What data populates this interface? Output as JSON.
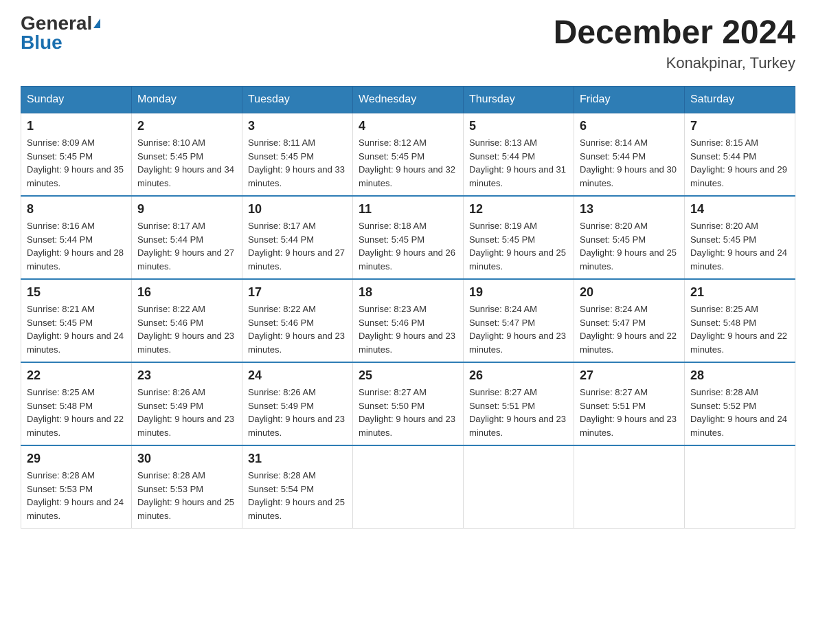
{
  "header": {
    "logo_general": "General",
    "logo_blue": "Blue",
    "title": "December 2024",
    "location": "Konakpinar, Turkey"
  },
  "weekdays": [
    "Sunday",
    "Monday",
    "Tuesday",
    "Wednesday",
    "Thursday",
    "Friday",
    "Saturday"
  ],
  "weeks": [
    [
      {
        "day": "1",
        "sunrise": "Sunrise: 8:09 AM",
        "sunset": "Sunset: 5:45 PM",
        "daylight": "Daylight: 9 hours and 35 minutes."
      },
      {
        "day": "2",
        "sunrise": "Sunrise: 8:10 AM",
        "sunset": "Sunset: 5:45 PM",
        "daylight": "Daylight: 9 hours and 34 minutes."
      },
      {
        "day": "3",
        "sunrise": "Sunrise: 8:11 AM",
        "sunset": "Sunset: 5:45 PM",
        "daylight": "Daylight: 9 hours and 33 minutes."
      },
      {
        "day": "4",
        "sunrise": "Sunrise: 8:12 AM",
        "sunset": "Sunset: 5:45 PM",
        "daylight": "Daylight: 9 hours and 32 minutes."
      },
      {
        "day": "5",
        "sunrise": "Sunrise: 8:13 AM",
        "sunset": "Sunset: 5:44 PM",
        "daylight": "Daylight: 9 hours and 31 minutes."
      },
      {
        "day": "6",
        "sunrise": "Sunrise: 8:14 AM",
        "sunset": "Sunset: 5:44 PM",
        "daylight": "Daylight: 9 hours and 30 minutes."
      },
      {
        "day": "7",
        "sunrise": "Sunrise: 8:15 AM",
        "sunset": "Sunset: 5:44 PM",
        "daylight": "Daylight: 9 hours and 29 minutes."
      }
    ],
    [
      {
        "day": "8",
        "sunrise": "Sunrise: 8:16 AM",
        "sunset": "Sunset: 5:44 PM",
        "daylight": "Daylight: 9 hours and 28 minutes."
      },
      {
        "day": "9",
        "sunrise": "Sunrise: 8:17 AM",
        "sunset": "Sunset: 5:44 PM",
        "daylight": "Daylight: 9 hours and 27 minutes."
      },
      {
        "day": "10",
        "sunrise": "Sunrise: 8:17 AM",
        "sunset": "Sunset: 5:44 PM",
        "daylight": "Daylight: 9 hours and 27 minutes."
      },
      {
        "day": "11",
        "sunrise": "Sunrise: 8:18 AM",
        "sunset": "Sunset: 5:45 PM",
        "daylight": "Daylight: 9 hours and 26 minutes."
      },
      {
        "day": "12",
        "sunrise": "Sunrise: 8:19 AM",
        "sunset": "Sunset: 5:45 PM",
        "daylight": "Daylight: 9 hours and 25 minutes."
      },
      {
        "day": "13",
        "sunrise": "Sunrise: 8:20 AM",
        "sunset": "Sunset: 5:45 PM",
        "daylight": "Daylight: 9 hours and 25 minutes."
      },
      {
        "day": "14",
        "sunrise": "Sunrise: 8:20 AM",
        "sunset": "Sunset: 5:45 PM",
        "daylight": "Daylight: 9 hours and 24 minutes."
      }
    ],
    [
      {
        "day": "15",
        "sunrise": "Sunrise: 8:21 AM",
        "sunset": "Sunset: 5:45 PM",
        "daylight": "Daylight: 9 hours and 24 minutes."
      },
      {
        "day": "16",
        "sunrise": "Sunrise: 8:22 AM",
        "sunset": "Sunset: 5:46 PM",
        "daylight": "Daylight: 9 hours and 23 minutes."
      },
      {
        "day": "17",
        "sunrise": "Sunrise: 8:22 AM",
        "sunset": "Sunset: 5:46 PM",
        "daylight": "Daylight: 9 hours and 23 minutes."
      },
      {
        "day": "18",
        "sunrise": "Sunrise: 8:23 AM",
        "sunset": "Sunset: 5:46 PM",
        "daylight": "Daylight: 9 hours and 23 minutes."
      },
      {
        "day": "19",
        "sunrise": "Sunrise: 8:24 AM",
        "sunset": "Sunset: 5:47 PM",
        "daylight": "Daylight: 9 hours and 23 minutes."
      },
      {
        "day": "20",
        "sunrise": "Sunrise: 8:24 AM",
        "sunset": "Sunset: 5:47 PM",
        "daylight": "Daylight: 9 hours and 22 minutes."
      },
      {
        "day": "21",
        "sunrise": "Sunrise: 8:25 AM",
        "sunset": "Sunset: 5:48 PM",
        "daylight": "Daylight: 9 hours and 22 minutes."
      }
    ],
    [
      {
        "day": "22",
        "sunrise": "Sunrise: 8:25 AM",
        "sunset": "Sunset: 5:48 PM",
        "daylight": "Daylight: 9 hours and 22 minutes."
      },
      {
        "day": "23",
        "sunrise": "Sunrise: 8:26 AM",
        "sunset": "Sunset: 5:49 PM",
        "daylight": "Daylight: 9 hours and 23 minutes."
      },
      {
        "day": "24",
        "sunrise": "Sunrise: 8:26 AM",
        "sunset": "Sunset: 5:49 PM",
        "daylight": "Daylight: 9 hours and 23 minutes."
      },
      {
        "day": "25",
        "sunrise": "Sunrise: 8:27 AM",
        "sunset": "Sunset: 5:50 PM",
        "daylight": "Daylight: 9 hours and 23 minutes."
      },
      {
        "day": "26",
        "sunrise": "Sunrise: 8:27 AM",
        "sunset": "Sunset: 5:51 PM",
        "daylight": "Daylight: 9 hours and 23 minutes."
      },
      {
        "day": "27",
        "sunrise": "Sunrise: 8:27 AM",
        "sunset": "Sunset: 5:51 PM",
        "daylight": "Daylight: 9 hours and 23 minutes."
      },
      {
        "day": "28",
        "sunrise": "Sunrise: 8:28 AM",
        "sunset": "Sunset: 5:52 PM",
        "daylight": "Daylight: 9 hours and 24 minutes."
      }
    ],
    [
      {
        "day": "29",
        "sunrise": "Sunrise: 8:28 AM",
        "sunset": "Sunset: 5:53 PM",
        "daylight": "Daylight: 9 hours and 24 minutes."
      },
      {
        "day": "30",
        "sunrise": "Sunrise: 8:28 AM",
        "sunset": "Sunset: 5:53 PM",
        "daylight": "Daylight: 9 hours and 25 minutes."
      },
      {
        "day": "31",
        "sunrise": "Sunrise: 8:28 AM",
        "sunset": "Sunset: 5:54 PM",
        "daylight": "Daylight: 9 hours and 25 minutes."
      },
      null,
      null,
      null,
      null
    ]
  ]
}
